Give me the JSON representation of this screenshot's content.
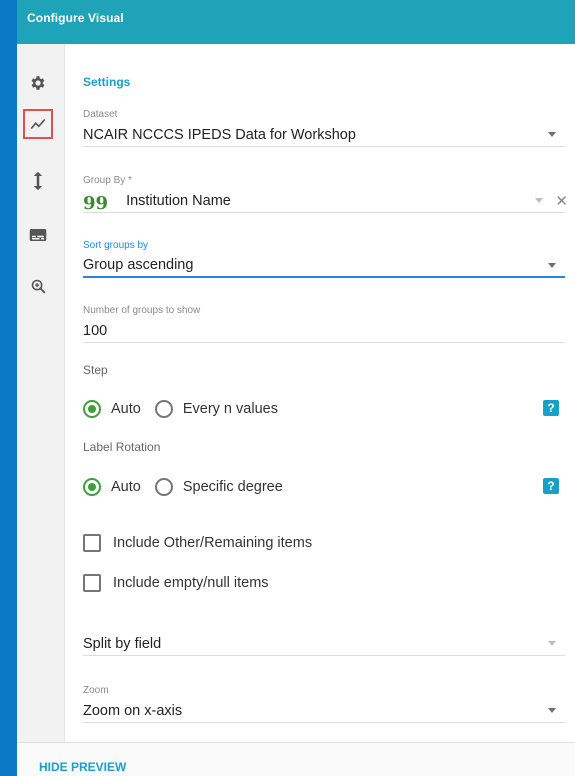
{
  "header": {
    "title": "Configure Visual"
  },
  "sidebar": {
    "items": [
      {
        "name": "settings",
        "icon": "gear-icon"
      },
      {
        "name": "chart",
        "icon": "line-chart-icon",
        "active": true
      },
      {
        "name": "sort",
        "icon": "vertical-arrows-icon"
      },
      {
        "name": "legend",
        "icon": "subtitles-icon"
      },
      {
        "name": "zoom",
        "icon": "zoom-in-icon"
      }
    ]
  },
  "settings": {
    "title": "Settings",
    "dataset": {
      "label": "Dataset",
      "value": "NCAIR NCCCS IPEDS Data for Workshop"
    },
    "group_by": {
      "label": "Group By *",
      "value": "Institution Name",
      "clear": "✕"
    },
    "sort_groups": {
      "label": "Sort groups by",
      "value": "Group ascending"
    },
    "num_groups": {
      "label": "Number of groups to show",
      "value": "100"
    },
    "step": {
      "label": "Step",
      "options": [
        {
          "label": "Auto",
          "selected": true
        },
        {
          "label": "Every n values",
          "selected": false
        }
      ],
      "help": "?"
    },
    "label_rotation": {
      "label": "Label Rotation",
      "options": [
        {
          "label": "Auto",
          "selected": true
        },
        {
          "label": "Specific degree",
          "selected": false
        }
      ],
      "help": "?"
    },
    "include_other": {
      "label": "Include Other/Remaining items",
      "checked": false
    },
    "include_empty": {
      "label": "Include empty/null items",
      "checked": false
    },
    "split_by": {
      "placeholder": "Split by field"
    },
    "zoom": {
      "label": "Zoom",
      "value": "Zoom on x-axis"
    }
  },
  "footer": {
    "hide_preview": "HIDE PREVIEW"
  },
  "colors": {
    "header": "#1fa3b8",
    "accent": "#1aa0c6",
    "radio_on": "#3c9e3c",
    "active_outline": "#e0504f",
    "background": "#0a78c4"
  }
}
